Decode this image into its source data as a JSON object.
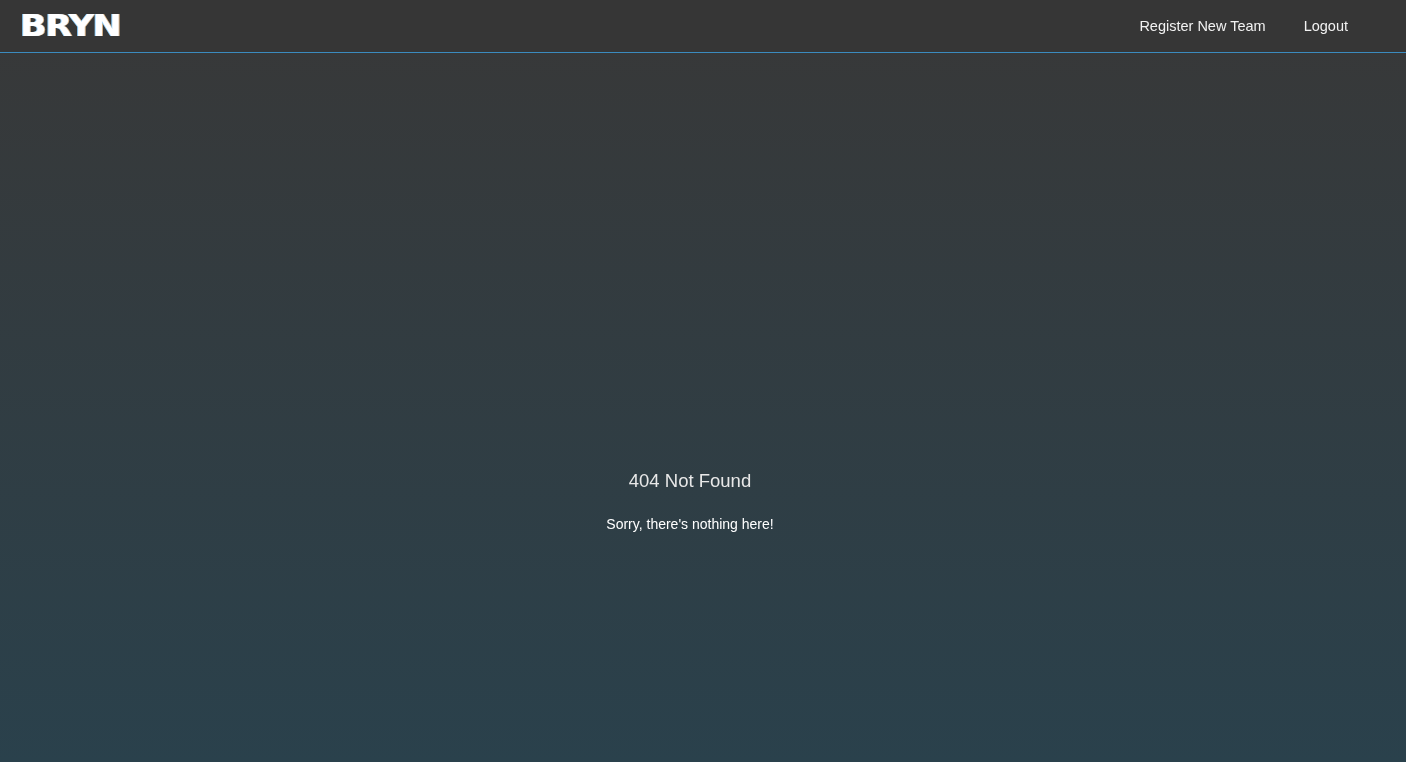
{
  "header": {
    "logo": "BRYN",
    "nav_links": [
      "Register New Team",
      "Logout"
    ]
  },
  "content": {
    "title": "404 Not Found",
    "message": "Sorry, there's nothing here!"
  }
}
